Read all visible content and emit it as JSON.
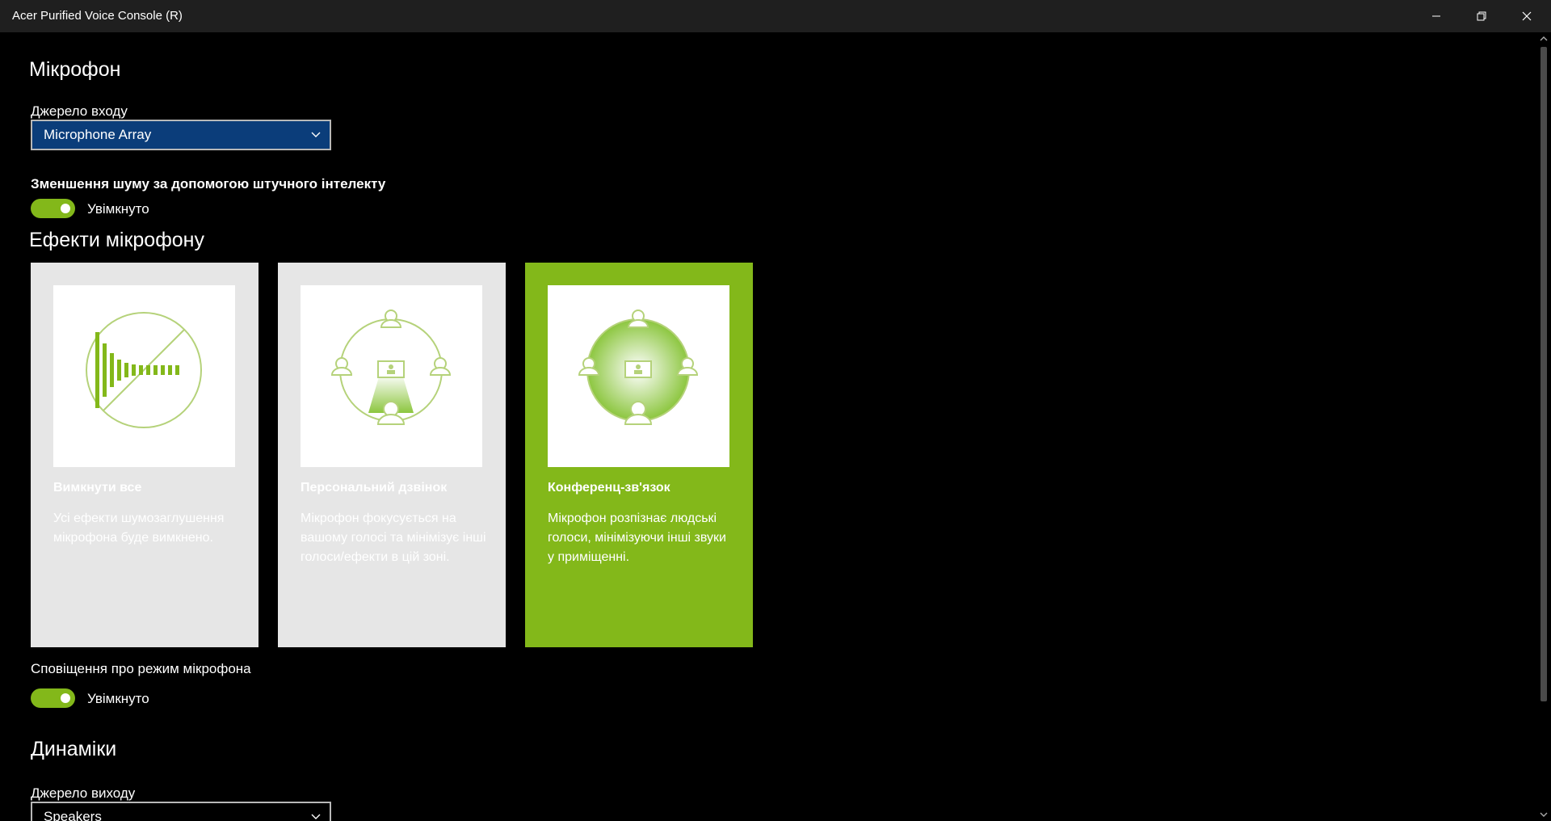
{
  "window": {
    "title": "Acer Purified Voice Console (R)"
  },
  "microphone": {
    "heading": "Мікрофон",
    "input_source_label": "Джерело входу",
    "input_source_value": "Microphone Array",
    "ai_noise_label": "Зменшення шуму за допомогою штучного інтелекту",
    "ai_noise_state": "Увімкнуто",
    "effects_heading": "Ефекти мікрофону",
    "effects": [
      {
        "title": "Вимкнути все",
        "description": "Усі ефекти шумозаглушення мікрофона буде вимкнено.",
        "selected": false
      },
      {
        "title": "Персональний дзвінок",
        "description": "Мікрофон фокусується на вашому голосі та мінімізує інші голоси/ефекти в цій зоні.",
        "selected": false
      },
      {
        "title": "Конференц-зв'язок",
        "description": "Мікрофон розпізнає людські голоси, мінімізуючи інші звуки у приміщенні.",
        "selected": true
      }
    ],
    "notification_label": "Сповіщення про режим мікрофона",
    "notification_state": "Увімкнуто"
  },
  "speakers": {
    "heading": "Динаміки",
    "output_source_label": "Джерело виходу",
    "output_source_value": "Speakers"
  },
  "colors": {
    "accent_green": "#83b81a",
    "dropdown_active": "#0b3d7a",
    "card_bg": "#e6e6e6",
    "titlebar_bg": "#1f1f1f"
  }
}
